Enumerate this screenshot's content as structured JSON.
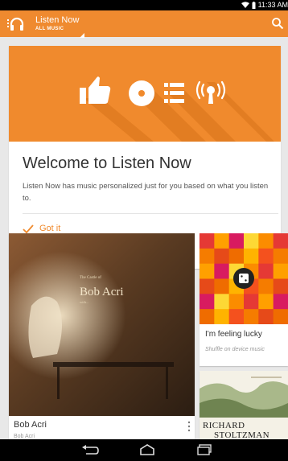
{
  "status_bar": {
    "time": "11:33 AM"
  },
  "app_bar": {
    "title": "Listen Now",
    "subtitle": "ALL MUSIC",
    "brand_color": "#ef8a2f"
  },
  "welcome_card": {
    "hero_icons": [
      "thumbs-up-icon",
      "disc-icon",
      "list-icon",
      "radio-icon"
    ],
    "title": "Welcome to Listen Now",
    "body": "Listen Now has music personalized just for you based on what you listen to.",
    "action": "Got it"
  },
  "cards": [
    {
      "title": "Bob Acri",
      "subtitle": "Bob Acri",
      "art_text": [
        "The Castle of",
        "Bob Acri",
        "with..."
      ]
    },
    {
      "title": "I'm feeling lucky",
      "subtitle": "Shuffle on device music",
      "icon": "dice-icon"
    },
    {
      "art_text": [
        "RICHARD",
        "STOLTZMAN"
      ]
    }
  ],
  "nav_bar": {
    "buttons": [
      "back-icon",
      "home-icon",
      "recents-icon"
    ]
  }
}
